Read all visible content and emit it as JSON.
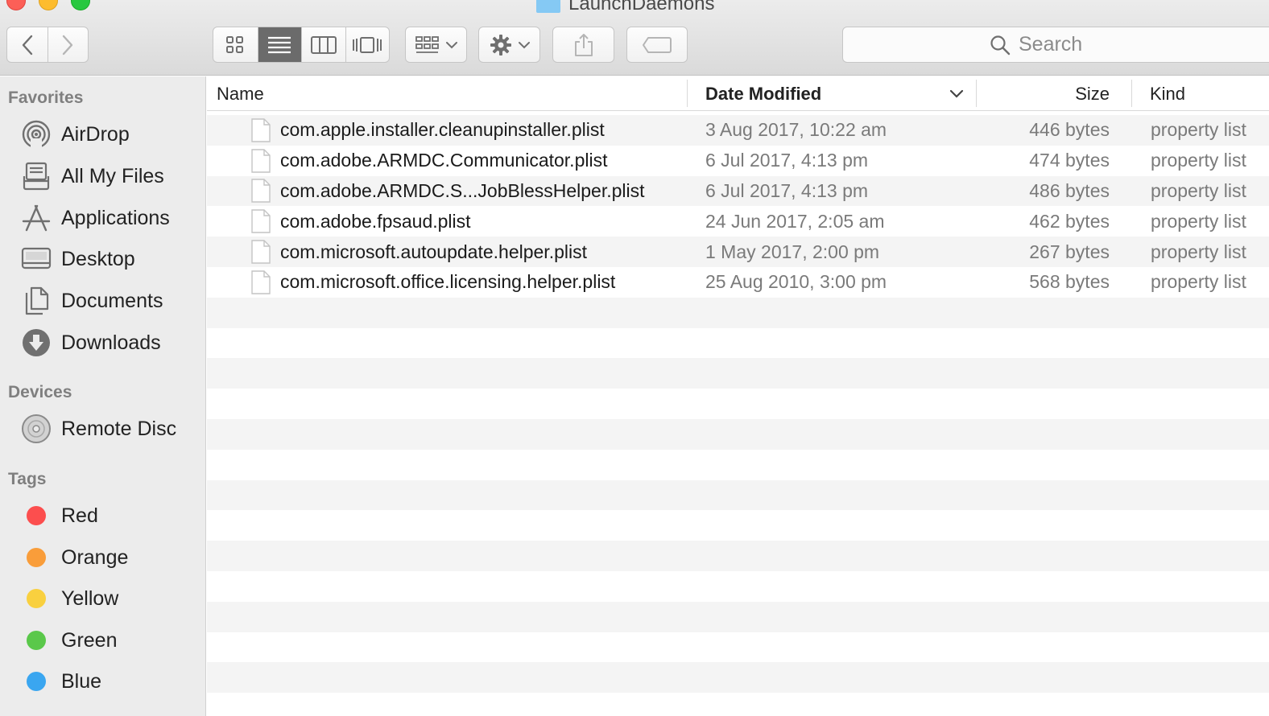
{
  "window": {
    "title": "LaunchDaemons"
  },
  "toolbar": {
    "back_icon": "chevron-left-icon",
    "forward_icon": "chevron-right-icon",
    "views": [
      "icon-view",
      "list-view",
      "column-view",
      "cover-flow-view"
    ],
    "active_view": "list-view",
    "search_placeholder": "Search"
  },
  "sidebar": {
    "favorites_heading": "Favorites",
    "favorites": [
      {
        "label": "AirDrop",
        "icon": "airdrop-icon"
      },
      {
        "label": "All My Files",
        "icon": "all-my-files-icon"
      },
      {
        "label": "Applications",
        "icon": "applications-icon"
      },
      {
        "label": "Desktop",
        "icon": "desktop-icon"
      },
      {
        "label": "Documents",
        "icon": "documents-icon"
      },
      {
        "label": "Downloads",
        "icon": "downloads-icon"
      }
    ],
    "devices_heading": "Devices",
    "devices": [
      {
        "label": "Remote Disc",
        "icon": "disc-icon"
      }
    ],
    "tags_heading": "Tags",
    "tags": [
      {
        "label": "Red",
        "color": "#fc4e4e"
      },
      {
        "label": "Orange",
        "color": "#f99d3a"
      },
      {
        "label": "Yellow",
        "color": "#f9d03f"
      },
      {
        "label": "Green",
        "color": "#5ac84a"
      },
      {
        "label": "Blue",
        "color": "#3aa6f0"
      }
    ]
  },
  "file_list": {
    "columns": {
      "name": "Name",
      "date": "Date Modified",
      "size": "Size",
      "kind": "Kind"
    },
    "sorted_by": "Date Modified",
    "rows": [
      {
        "name": "com.apple.installer.cleanupinstaller.plist",
        "date": "3 Aug 2017, 10:22 am",
        "size": "446 bytes",
        "kind": "property list"
      },
      {
        "name": "com.adobe.ARMDC.Communicator.plist",
        "date": "6 Jul 2017, 4:13 pm",
        "size": "474 bytes",
        "kind": "property list"
      },
      {
        "name": "com.adobe.ARMDC.S...JobBlessHelper.plist",
        "date": "6 Jul 2017, 4:13 pm",
        "size": "486 bytes",
        "kind": "property list"
      },
      {
        "name": "com.adobe.fpsaud.plist",
        "date": "24 Jun 2017, 2:05 am",
        "size": "462 bytes",
        "kind": "property list"
      },
      {
        "name": "com.microsoft.autoupdate.helper.plist",
        "date": "1 May 2017, 2:00 pm",
        "size": "267 bytes",
        "kind": "property list"
      },
      {
        "name": "com.microsoft.office.licensing.helper.plist",
        "date": "25 Aug 2010, 3:00 pm",
        "size": "568 bytes",
        "kind": "property list"
      }
    ]
  }
}
